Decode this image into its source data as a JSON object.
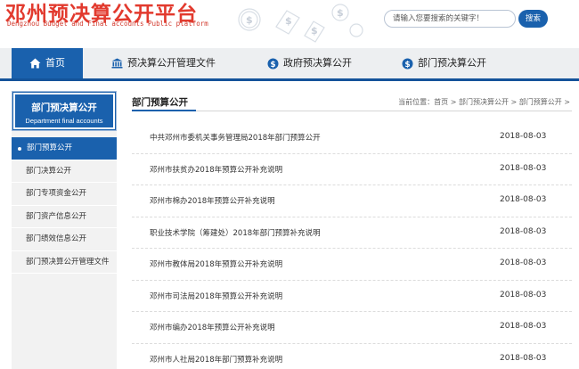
{
  "header": {
    "title": "邓州预决算公开平台",
    "subtitle": "Dengzhou Budget and Final accounts Public platform",
    "search_placeholder": "请输入您要搜索的关键字！",
    "search_button": "搜索"
  },
  "nav": {
    "items": [
      {
        "label": "首页",
        "icon": "home-icon"
      },
      {
        "label": "预决算公开管理文件",
        "icon": "bank-icon"
      },
      {
        "label": "政府预决算公开",
        "icon": "dollar-circle-icon"
      },
      {
        "label": "部门预决算公开",
        "icon": "dollar-circle-icon"
      }
    ],
    "active_index": 0
  },
  "sidebar": {
    "title": "部门预决算公开",
    "title_en": "Department final accounts",
    "items": [
      {
        "label": "部门预算公开"
      },
      {
        "label": "部门决算公开"
      },
      {
        "label": "部门专项资金公开"
      },
      {
        "label": "部门资产信息公开"
      },
      {
        "label": "部门绩效信息公开"
      },
      {
        "label": "部门预决算公开管理文件"
      }
    ],
    "active_index": 0
  },
  "main": {
    "title": "部门预算公开",
    "breadcrumb": "当前位置：首页 > 部门预决算公开 > 部门预算公开 >",
    "rows": [
      {
        "title": "中共邓州市委机关事务管理局2018年部门预算公开",
        "date": "2018-08-03"
      },
      {
        "title": "邓州市扶贫办2018年预算公开补充说明",
        "date": "2018-08-03"
      },
      {
        "title": "邓州市棉办2018年预算公开补充说明",
        "date": "2018-08-03"
      },
      {
        "title": "职业技术学院（筹建处）2018年部门预算补充说明",
        "date": "2018-08-03"
      },
      {
        "title": "邓州市教体局2018年预算公开补充说明",
        "date": "2018-08-03"
      },
      {
        "title": "邓州市司法局2018年预算公开补充说明",
        "date": "2018-08-03"
      },
      {
        "title": "邓州市编办2018年预算公开补充说明",
        "date": "2018-08-03"
      },
      {
        "title": "邓州市人社局2018年部门预算补充说明",
        "date": "2018-08-03"
      }
    ]
  },
  "colors": {
    "brand_red": "#e23a2e",
    "primary_blue": "#1a61ad",
    "nav_bg": "#edeff1",
    "sidebar_bg": "#f2f2f2"
  }
}
